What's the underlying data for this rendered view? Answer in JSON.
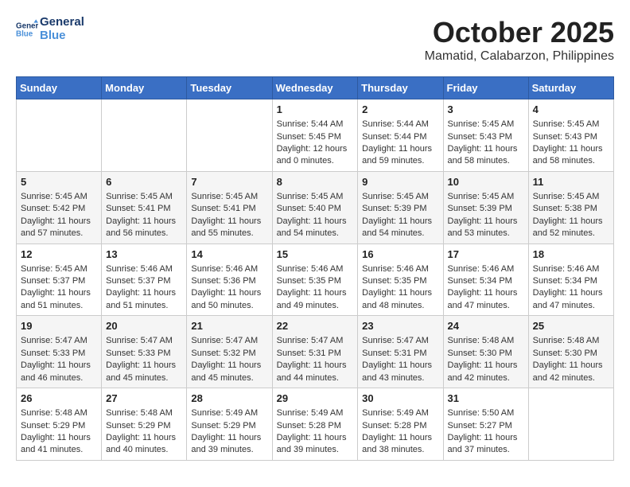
{
  "header": {
    "logo_line1": "General",
    "logo_line2": "Blue",
    "month": "October 2025",
    "location": "Mamatid, Calabarzon, Philippines"
  },
  "days_of_week": [
    "Sunday",
    "Monday",
    "Tuesday",
    "Wednesday",
    "Thursday",
    "Friday",
    "Saturday"
  ],
  "weeks": [
    [
      {
        "day": "",
        "sunrise": "",
        "sunset": "",
        "daylight": ""
      },
      {
        "day": "",
        "sunrise": "",
        "sunset": "",
        "daylight": ""
      },
      {
        "day": "",
        "sunrise": "",
        "sunset": "",
        "daylight": ""
      },
      {
        "day": "1",
        "sunrise": "Sunrise: 5:44 AM",
        "sunset": "Sunset: 5:45 PM",
        "daylight": "Daylight: 12 hours and 0 minutes."
      },
      {
        "day": "2",
        "sunrise": "Sunrise: 5:44 AM",
        "sunset": "Sunset: 5:44 PM",
        "daylight": "Daylight: 11 hours and 59 minutes."
      },
      {
        "day": "3",
        "sunrise": "Sunrise: 5:45 AM",
        "sunset": "Sunset: 5:43 PM",
        "daylight": "Daylight: 11 hours and 58 minutes."
      },
      {
        "day": "4",
        "sunrise": "Sunrise: 5:45 AM",
        "sunset": "Sunset: 5:43 PM",
        "daylight": "Daylight: 11 hours and 58 minutes."
      }
    ],
    [
      {
        "day": "5",
        "sunrise": "Sunrise: 5:45 AM",
        "sunset": "Sunset: 5:42 PM",
        "daylight": "Daylight: 11 hours and 57 minutes."
      },
      {
        "day": "6",
        "sunrise": "Sunrise: 5:45 AM",
        "sunset": "Sunset: 5:41 PM",
        "daylight": "Daylight: 11 hours and 56 minutes."
      },
      {
        "day": "7",
        "sunrise": "Sunrise: 5:45 AM",
        "sunset": "Sunset: 5:41 PM",
        "daylight": "Daylight: 11 hours and 55 minutes."
      },
      {
        "day": "8",
        "sunrise": "Sunrise: 5:45 AM",
        "sunset": "Sunset: 5:40 PM",
        "daylight": "Daylight: 11 hours and 54 minutes."
      },
      {
        "day": "9",
        "sunrise": "Sunrise: 5:45 AM",
        "sunset": "Sunset: 5:39 PM",
        "daylight": "Daylight: 11 hours and 54 minutes."
      },
      {
        "day": "10",
        "sunrise": "Sunrise: 5:45 AM",
        "sunset": "Sunset: 5:39 PM",
        "daylight": "Daylight: 11 hours and 53 minutes."
      },
      {
        "day": "11",
        "sunrise": "Sunrise: 5:45 AM",
        "sunset": "Sunset: 5:38 PM",
        "daylight": "Daylight: 11 hours and 52 minutes."
      }
    ],
    [
      {
        "day": "12",
        "sunrise": "Sunrise: 5:45 AM",
        "sunset": "Sunset: 5:37 PM",
        "daylight": "Daylight: 11 hours and 51 minutes."
      },
      {
        "day": "13",
        "sunrise": "Sunrise: 5:46 AM",
        "sunset": "Sunset: 5:37 PM",
        "daylight": "Daylight: 11 hours and 51 minutes."
      },
      {
        "day": "14",
        "sunrise": "Sunrise: 5:46 AM",
        "sunset": "Sunset: 5:36 PM",
        "daylight": "Daylight: 11 hours and 50 minutes."
      },
      {
        "day": "15",
        "sunrise": "Sunrise: 5:46 AM",
        "sunset": "Sunset: 5:35 PM",
        "daylight": "Daylight: 11 hours and 49 minutes."
      },
      {
        "day": "16",
        "sunrise": "Sunrise: 5:46 AM",
        "sunset": "Sunset: 5:35 PM",
        "daylight": "Daylight: 11 hours and 48 minutes."
      },
      {
        "day": "17",
        "sunrise": "Sunrise: 5:46 AM",
        "sunset": "Sunset: 5:34 PM",
        "daylight": "Daylight: 11 hours and 47 minutes."
      },
      {
        "day": "18",
        "sunrise": "Sunrise: 5:46 AM",
        "sunset": "Sunset: 5:34 PM",
        "daylight": "Daylight: 11 hours and 47 minutes."
      }
    ],
    [
      {
        "day": "19",
        "sunrise": "Sunrise: 5:47 AM",
        "sunset": "Sunset: 5:33 PM",
        "daylight": "Daylight: 11 hours and 46 minutes."
      },
      {
        "day": "20",
        "sunrise": "Sunrise: 5:47 AM",
        "sunset": "Sunset: 5:33 PM",
        "daylight": "Daylight: 11 hours and 45 minutes."
      },
      {
        "day": "21",
        "sunrise": "Sunrise: 5:47 AM",
        "sunset": "Sunset: 5:32 PM",
        "daylight": "Daylight: 11 hours and 45 minutes."
      },
      {
        "day": "22",
        "sunrise": "Sunrise: 5:47 AM",
        "sunset": "Sunset: 5:31 PM",
        "daylight": "Daylight: 11 hours and 44 minutes."
      },
      {
        "day": "23",
        "sunrise": "Sunrise: 5:47 AM",
        "sunset": "Sunset: 5:31 PM",
        "daylight": "Daylight: 11 hours and 43 minutes."
      },
      {
        "day": "24",
        "sunrise": "Sunrise: 5:48 AM",
        "sunset": "Sunset: 5:30 PM",
        "daylight": "Daylight: 11 hours and 42 minutes."
      },
      {
        "day": "25",
        "sunrise": "Sunrise: 5:48 AM",
        "sunset": "Sunset: 5:30 PM",
        "daylight": "Daylight: 11 hours and 42 minutes."
      }
    ],
    [
      {
        "day": "26",
        "sunrise": "Sunrise: 5:48 AM",
        "sunset": "Sunset: 5:29 PM",
        "daylight": "Daylight: 11 hours and 41 minutes."
      },
      {
        "day": "27",
        "sunrise": "Sunrise: 5:48 AM",
        "sunset": "Sunset: 5:29 PM",
        "daylight": "Daylight: 11 hours and 40 minutes."
      },
      {
        "day": "28",
        "sunrise": "Sunrise: 5:49 AM",
        "sunset": "Sunset: 5:29 PM",
        "daylight": "Daylight: 11 hours and 39 minutes."
      },
      {
        "day": "29",
        "sunrise": "Sunrise: 5:49 AM",
        "sunset": "Sunset: 5:28 PM",
        "daylight": "Daylight: 11 hours and 39 minutes."
      },
      {
        "day": "30",
        "sunrise": "Sunrise: 5:49 AM",
        "sunset": "Sunset: 5:28 PM",
        "daylight": "Daylight: 11 hours and 38 minutes."
      },
      {
        "day": "31",
        "sunrise": "Sunrise: 5:50 AM",
        "sunset": "Sunset: 5:27 PM",
        "daylight": "Daylight: 11 hours and 37 minutes."
      },
      {
        "day": "",
        "sunrise": "",
        "sunset": "",
        "daylight": ""
      }
    ]
  ]
}
